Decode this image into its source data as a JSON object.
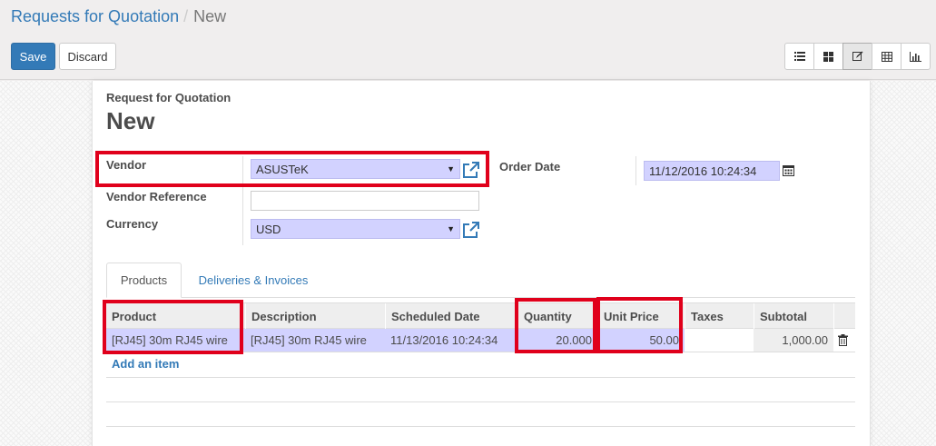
{
  "breadcrumb": {
    "parent": "Requests for Quotation",
    "separator": "/",
    "current": "New"
  },
  "buttons": {
    "save": "Save",
    "discard": "Discard"
  },
  "view_switcher": [
    {
      "name": "list-view-icon",
      "active": false
    },
    {
      "name": "kanban-view-icon",
      "active": false
    },
    {
      "name": "form-view-icon",
      "active": true
    },
    {
      "name": "pivot-view-icon",
      "active": false
    },
    {
      "name": "graph-view-icon",
      "active": false
    }
  ],
  "form": {
    "doc_type": "Request for Quotation",
    "doc_name": "New",
    "vendor_label": "Vendor",
    "vendor_value": "ASUSTeK",
    "vendor_ref_label": "Vendor Reference",
    "vendor_ref_value": "",
    "currency_label": "Currency",
    "currency_value": "USD",
    "order_date_label": "Order Date",
    "order_date_value": "11/12/2016 10:24:34"
  },
  "tabs": [
    {
      "label": "Products",
      "active": true
    },
    {
      "label": "Deliveries & Invoices",
      "active": false
    }
  ],
  "table": {
    "headers": {
      "product": "Product",
      "description": "Description",
      "scheduled_date": "Scheduled Date",
      "quantity": "Quantity",
      "unit_price": "Unit Price",
      "taxes": "Taxes",
      "subtotal": "Subtotal"
    },
    "rows": [
      {
        "product": "[RJ45] 30m RJ45 wire",
        "description": "[RJ45] 30m RJ45 wire",
        "scheduled_date": "11/13/2016 10:24:34",
        "quantity": "20.000",
        "unit_price": "50.00",
        "taxes": "",
        "subtotal": "1,000.00"
      }
    ],
    "add_item": "Add an item"
  },
  "colors": {
    "highlight": "#e0001b",
    "required_field": "#d2d2ff",
    "primary": "#337ab7"
  }
}
